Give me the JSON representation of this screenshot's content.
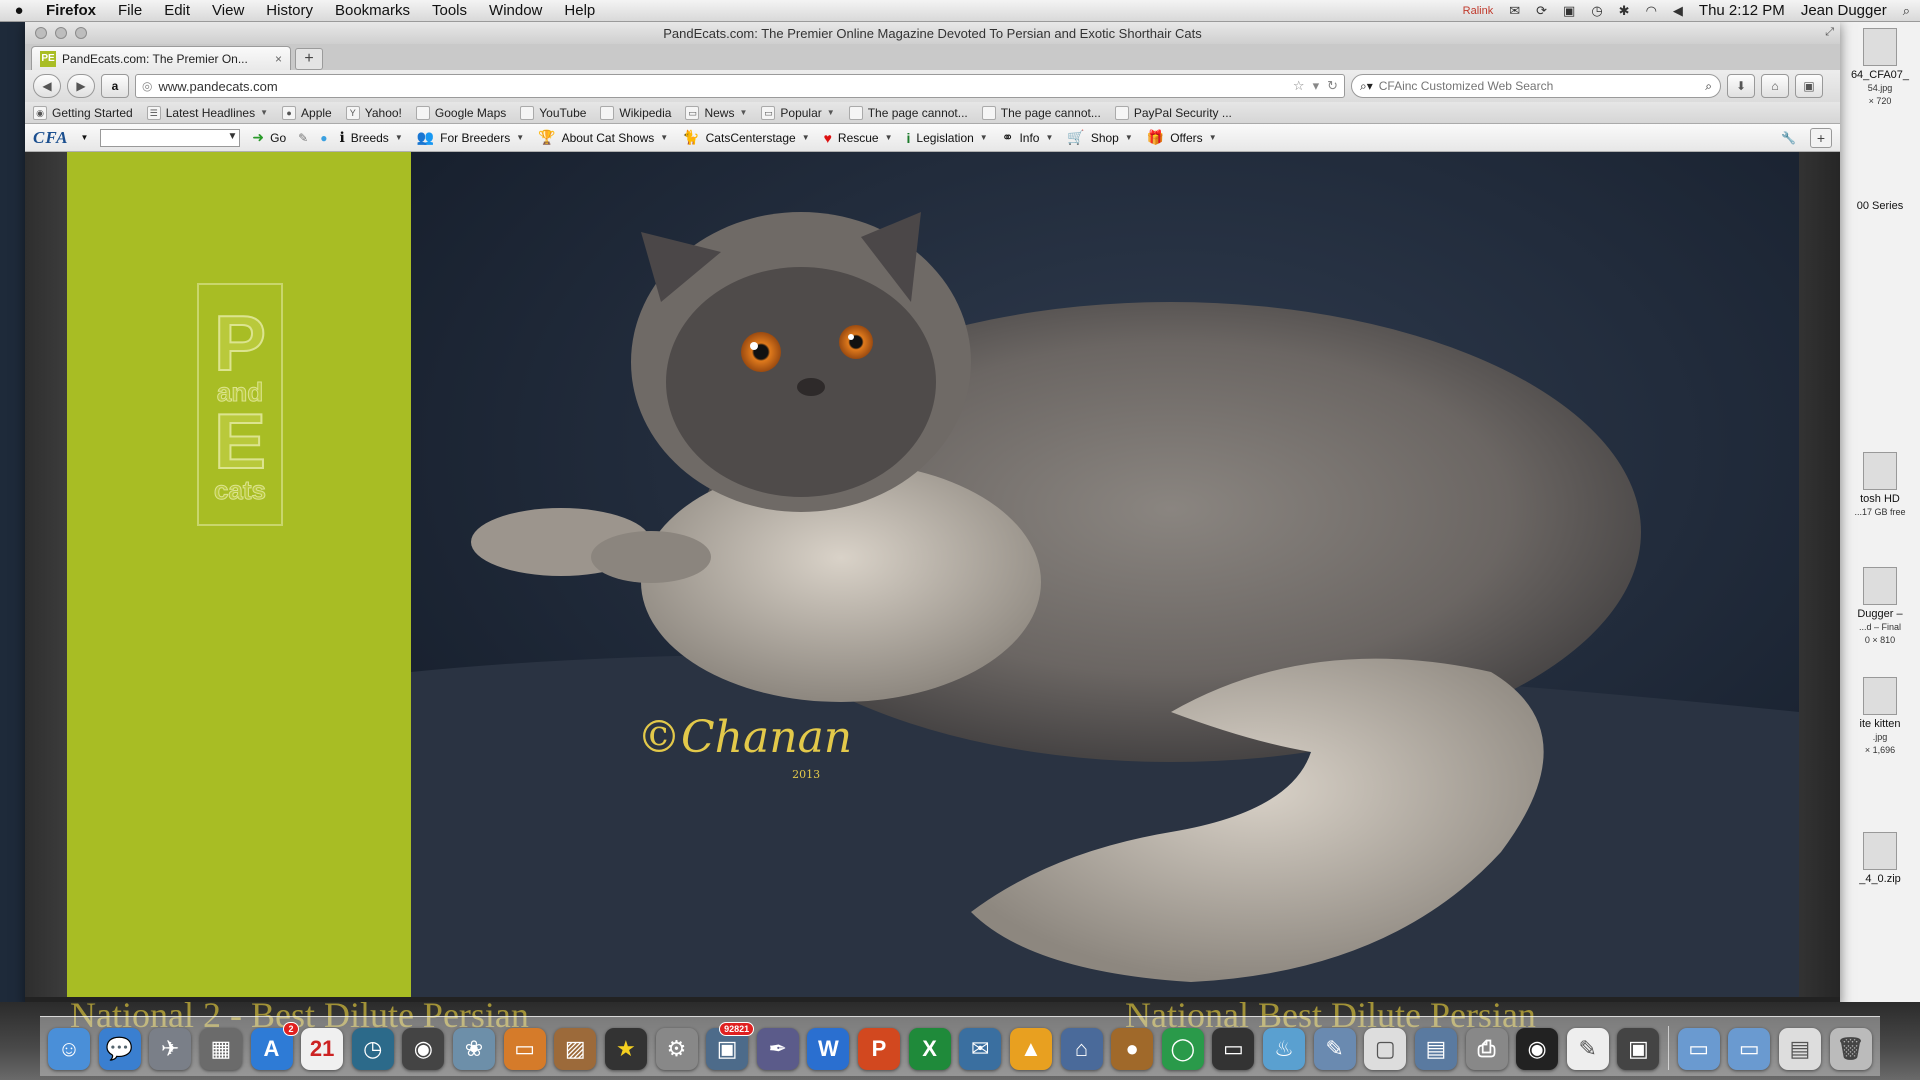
{
  "menubar": {
    "app": "Firefox",
    "items": [
      "File",
      "Edit",
      "View",
      "History",
      "Bookmarks",
      "Tools",
      "Window",
      "Help"
    ],
    "status_ralink": "Ralink",
    "clock": "Thu 2:12 PM",
    "user": "Jean Dugger"
  },
  "window": {
    "title": "PandEcats.com: The Premier Online Magazine Devoted To Persian and Exotic Shorthair Cats"
  },
  "tab": {
    "favicon": "PE",
    "title": "PandEcats.com: The Premier On..."
  },
  "nav": {
    "url": "www.pandecats.com",
    "search_placeholder": "CFAinc Customized Web Search"
  },
  "bookmarks": [
    {
      "label": "Getting Started",
      "icon": "firefox-icon",
      "caret": false
    },
    {
      "label": "Latest Headlines",
      "icon": "rss-icon",
      "caret": true
    },
    {
      "label": "Apple",
      "icon": "apple-icon",
      "caret": false
    },
    {
      "label": "Yahoo!",
      "icon": "yahoo-icon",
      "caret": false
    },
    {
      "label": "Google Maps",
      "icon": "page-icon",
      "caret": false
    },
    {
      "label": "YouTube",
      "icon": "page-icon",
      "caret": false
    },
    {
      "label": "Wikipedia",
      "icon": "page-icon",
      "caret": false
    },
    {
      "label": "News",
      "icon": "folder-icon",
      "caret": true
    },
    {
      "label": "Popular",
      "icon": "folder-icon",
      "caret": true
    },
    {
      "label": "The page cannot...",
      "icon": "page-icon",
      "caret": false
    },
    {
      "label": "The page cannot...",
      "icon": "page-icon",
      "caret": false
    },
    {
      "label": "PayPal Security ...",
      "icon": "page-icon",
      "caret": false
    }
  ],
  "cfa_toolbar": {
    "logo": "CFA",
    "go": "Go",
    "buttons": [
      {
        "label": "Breeds",
        "icon": "info-icon",
        "glyph": "ℹ"
      },
      {
        "label": "For Breeders",
        "icon": "people-icon",
        "glyph": "👥"
      },
      {
        "label": "About Cat Shows",
        "icon": "trophy-icon",
        "glyph": "🏆"
      },
      {
        "label": "CatsCenterstage",
        "icon": "cats-icon",
        "glyph": "🐈"
      },
      {
        "label": "Rescue",
        "icon": "heart-icon",
        "glyph": "♥"
      },
      {
        "label": "Legislation",
        "icon": "info-icon",
        "glyph": "i"
      },
      {
        "label": "Info",
        "icon": "link-icon",
        "glyph": "⚭"
      },
      {
        "label": "Shop",
        "icon": "cart-icon",
        "glyph": "🛒"
      },
      {
        "label": "Offers",
        "icon": "gift-icon",
        "glyph": "🎁"
      }
    ]
  },
  "page": {
    "logo_p": "P",
    "logo_and": "and",
    "logo_e": "E",
    "logo_cats": "cats",
    "signature": "©Chanan",
    "signature_year": "2013",
    "green": "#a8bd24"
  },
  "desktop": [
    {
      "label": "64_CFA07_",
      "sub": "54.jpg",
      "extra": "× 720"
    },
    {
      "label": "00 Series",
      "sub": "",
      "extra": ""
    },
    {
      "label": "tosh HD",
      "sub": "...17 GB free",
      "extra": ""
    },
    {
      "label": "Dugger –",
      "sub": "...d – Final",
      "extra": "0 × 810"
    },
    {
      "label": "ite kitten",
      "sub": ".jpg",
      "extra": "× 1,696"
    },
    {
      "label": "_4_0.zip",
      "sub": "",
      "extra": ""
    }
  ],
  "dock_banners": [
    "National 2 - Best Dilute Persian",
    "National Best Dilute Persian"
  ],
  "dock_badges": {
    "appstore": "2",
    "iphoto": "92821"
  }
}
